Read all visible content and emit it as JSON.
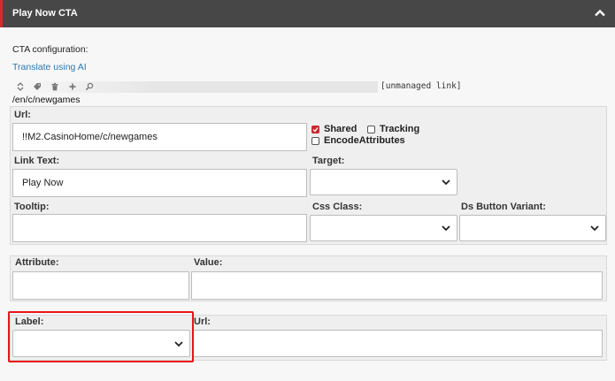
{
  "header": {
    "title": "Play Now CTA",
    "collapse_icon": "chevron-up-icon"
  },
  "cta": {
    "config_label": "CTA configuration:",
    "translate_link": "Translate using AI",
    "toolbar_icons": [
      "sort-icon",
      "tag-icon",
      "trash-icon",
      "plus-icon",
      "search-icon"
    ],
    "unmanaged": "[unmanaged link]",
    "path": "/en/c/newgames"
  },
  "fields": {
    "url": {
      "label": "Url:",
      "value": "!!M2.CasinoHome/c/newgames"
    },
    "shared": {
      "label": "Shared",
      "checked": true
    },
    "tracking": {
      "label": "Tracking",
      "checked": false
    },
    "encode": {
      "label": "EncodeAttributes",
      "checked": false
    },
    "link_text": {
      "label": "Link Text:",
      "value": "Play Now"
    },
    "target": {
      "label": "Target:",
      "value": ""
    },
    "tooltip": {
      "label": "Tooltip:",
      "value": ""
    },
    "css_class": {
      "label": "Css Class:",
      "value": ""
    },
    "ds_variant": {
      "label": "Ds Button Variant:",
      "value": ""
    },
    "attribute": {
      "label": "Attribute:",
      "value": ""
    },
    "attr_value": {
      "label": "Value:",
      "value": ""
    },
    "label2": {
      "label": "Label:",
      "value": ""
    },
    "url2": {
      "label": "Url:",
      "value": ""
    }
  },
  "colors": {
    "header_bg": "#474747",
    "accent_red": "#d72b2b",
    "link_blue": "#2a7ab0",
    "highlight": "#e8141b"
  }
}
